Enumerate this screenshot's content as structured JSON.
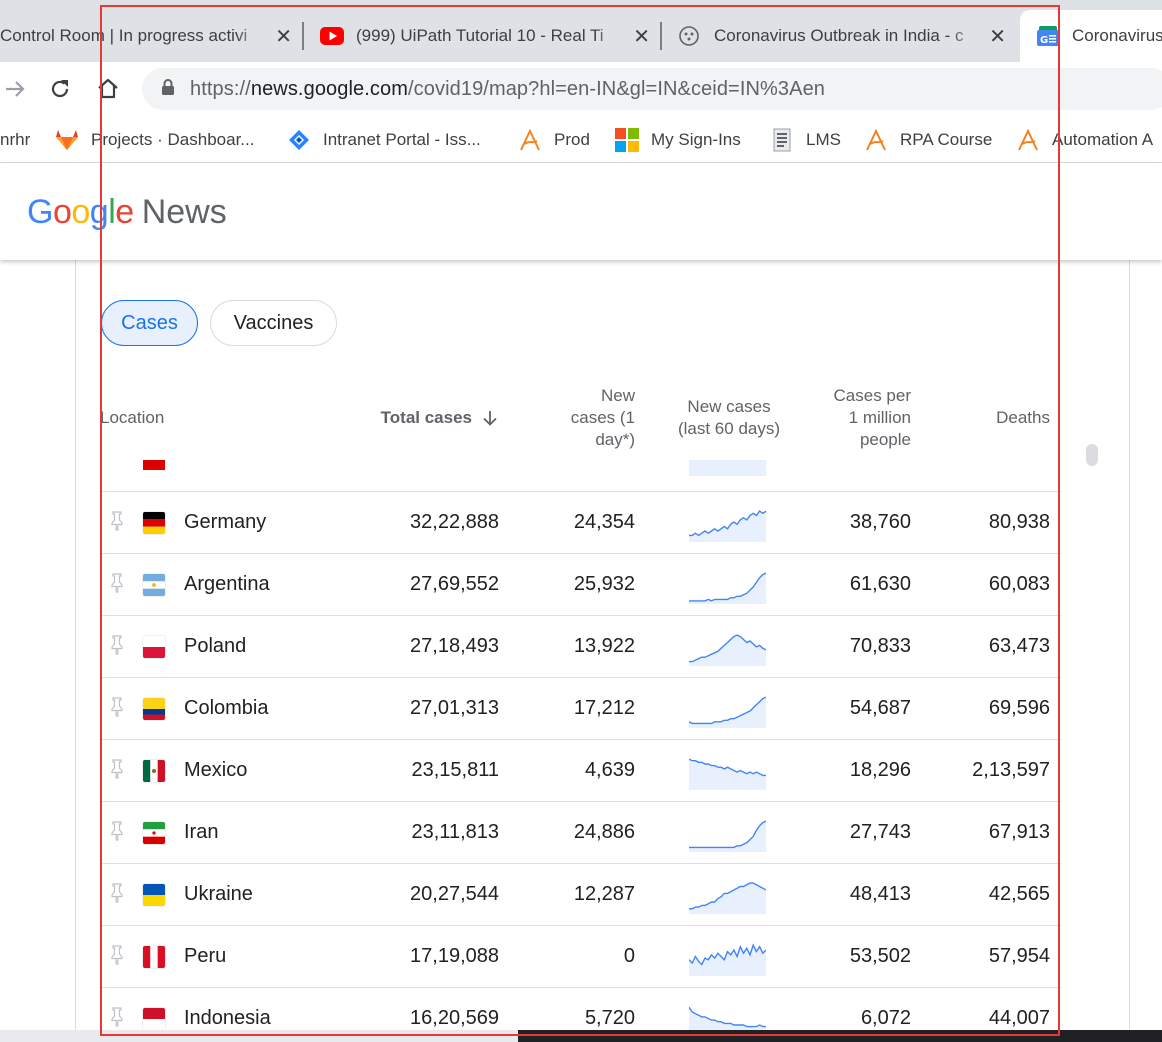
{
  "tabs": [
    {
      "title": "Control Room | In progress activi",
      "icon": "uipath-icon"
    },
    {
      "title": "(999) UiPath Tutorial 10 - Real Ti",
      "icon": "youtube-icon"
    },
    {
      "title": "Coronavirus Outbreak in India - c",
      "icon": "virus-icon"
    },
    {
      "title": "Coronavirus",
      "icon": "google-news-icon"
    }
  ],
  "address_bar": {
    "url_prefix": "https://",
    "url_host": "news.google.com",
    "url_path": "/covid19/map?hl=en-IN&gl=IN&ceid=IN%3Aen"
  },
  "bookmarks": [
    {
      "label": "nrhr",
      "icon": "none"
    },
    {
      "label": "Projects · Dashboar...",
      "icon": "gitlab-icon"
    },
    {
      "label": "Intranet Portal - Iss...",
      "icon": "jira-icon"
    },
    {
      "label": "Prod",
      "icon": "automation-anywhere-icon"
    },
    {
      "label": "My Sign-Ins",
      "icon": "microsoft-icon"
    },
    {
      "label": "LMS",
      "icon": "document-icon"
    },
    {
      "label": "RPA Course",
      "icon": "automation-anywhere-icon"
    },
    {
      "label": "Automation A",
      "icon": "automation-anywhere-icon"
    }
  ],
  "header": {
    "logo_google": "Google",
    "logo_news": "News"
  },
  "filters": {
    "cases": "Cases",
    "vaccines": "Vaccines",
    "selected": "Cases"
  },
  "table": {
    "columns": {
      "location": "Location",
      "total_cases": "Total cases",
      "new_cases_line1": "New",
      "new_cases_line2": "cases (1",
      "new_cases_line3": "day*)",
      "new_60_line1": "New cases",
      "new_60_line2": "(last 60 days)",
      "cpm_line1": "Cases per",
      "cpm_line2": "1 million",
      "cpm_line3": "people",
      "deaths": "Deaths"
    },
    "sort_column": "total_cases",
    "sort_direction": "descending",
    "rows": [
      {
        "location": "Germany",
        "total": "32,22,888",
        "new": "24,354",
        "cpm": "38,760",
        "deaths": "80,938",
        "flag": "germany-flag",
        "trend": [
          3,
          3,
          4,
          3,
          4,
          5,
          4,
          5,
          6,
          5,
          6,
          7,
          6,
          8,
          9,
          8,
          10,
          11,
          10,
          12,
          13,
          12,
          14,
          13,
          14
        ]
      },
      {
        "location": "Argentina",
        "total": "27,69,552",
        "new": "25,932",
        "cpm": "61,630",
        "deaths": "60,083",
        "flag": "argentina-flag",
        "trend": [
          2,
          2,
          2,
          2,
          2,
          2,
          3,
          2,
          3,
          3,
          3,
          3,
          3,
          4,
          4,
          5,
          5,
          6,
          7,
          9,
          11,
          14,
          17,
          19,
          20
        ]
      },
      {
        "location": "Poland",
        "total": "27,18,493",
        "new": "13,922",
        "cpm": "70,833",
        "deaths": "63,473",
        "flag": "poland-flag",
        "trend": [
          3,
          3,
          4,
          5,
          6,
          6,
          7,
          8,
          9,
          10,
          12,
          14,
          16,
          18,
          20,
          21,
          20,
          18,
          16,
          17,
          15,
          13,
          14,
          12,
          11
        ]
      },
      {
        "location": "Colombia",
        "total": "27,01,313",
        "new": "17,212",
        "cpm": "54,687",
        "deaths": "69,596",
        "flag": "colombia-flag",
        "trend": [
          4,
          3,
          3,
          3,
          3,
          3,
          3,
          3,
          4,
          4,
          4,
          5,
          5,
          6,
          6,
          7,
          8,
          9,
          10,
          11,
          13,
          15,
          17,
          19,
          20
        ]
      },
      {
        "location": "Mexico",
        "total": "23,15,811",
        "new": "4,639",
        "cpm": "18,296",
        "deaths": "2,13,597",
        "flag": "mexico-flag",
        "trend": [
          19,
          18,
          18,
          17,
          17,
          16,
          16,
          15,
          15,
          14,
          14,
          13,
          14,
          13,
          12,
          11,
          12,
          11,
          10,
          11,
          10,
          11,
          10,
          9,
          9
        ]
      },
      {
        "location": "Iran",
        "total": "23,11,813",
        "new": "24,886",
        "cpm": "27,743",
        "deaths": "67,913",
        "flag": "iran-flag",
        "trend": [
          3,
          3,
          3,
          3,
          3,
          3,
          3,
          3,
          3,
          3,
          3,
          3,
          3,
          3,
          3,
          4,
          4,
          5,
          6,
          8,
          10,
          14,
          17,
          19,
          20
        ]
      },
      {
        "location": "Ukraine",
        "total": "20,27,544",
        "new": "12,287",
        "cpm": "48,413",
        "deaths": "42,565",
        "flag": "ukraine-flag",
        "trend": [
          3,
          3,
          4,
          4,
          5,
          5,
          6,
          7,
          7,
          9,
          10,
          12,
          12,
          13,
          14,
          15,
          16,
          16,
          17,
          18,
          18,
          17,
          16,
          15,
          14
        ]
      },
      {
        "location": "Peru",
        "total": "17,19,088",
        "new": "0",
        "cpm": "53,502",
        "deaths": "57,954",
        "flag": "peru-flag",
        "trend": [
          10,
          8,
          12,
          9,
          7,
          11,
          10,
          13,
          11,
          14,
          12,
          10,
          15,
          13,
          16,
          12,
          18,
          14,
          17,
          13,
          19,
          15,
          18,
          14,
          16
        ]
      },
      {
        "location": "Indonesia",
        "total": "16,20,569",
        "new": "5,720",
        "cpm": "6,072",
        "deaths": "44,007",
        "flag": "indonesia-flag",
        "trend": [
          19,
          16,
          15,
          14,
          13,
          13,
          12,
          11,
          11,
          10,
          10,
          9,
          9,
          9,
          8,
          8,
          8,
          8,
          7,
          7,
          7,
          7,
          8,
          7,
          7
        ]
      }
    ]
  },
  "colors": {
    "accent": "#1a73e8",
    "spark_line": "#4285f4",
    "spark_fill": "#e8f0fe",
    "highlight_border": "#e53935"
  }
}
